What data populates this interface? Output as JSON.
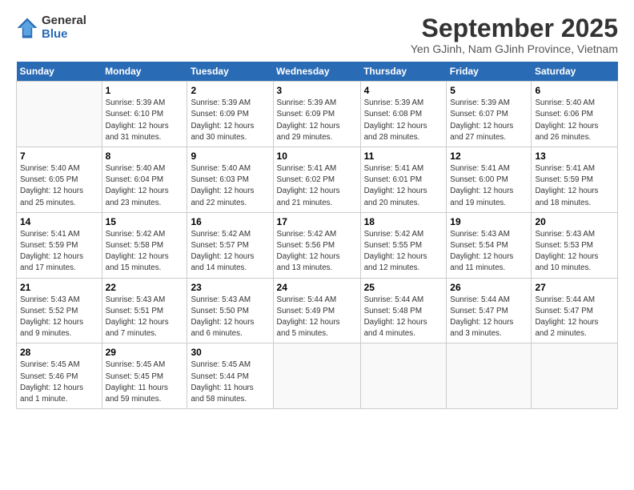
{
  "logo": {
    "general": "General",
    "blue": "Blue"
  },
  "title": "September 2025",
  "location": "Yen GJinh, Nam GJinh Province, Vietnam",
  "days_header": [
    "Sunday",
    "Monday",
    "Tuesday",
    "Wednesday",
    "Thursday",
    "Friday",
    "Saturday"
  ],
  "weeks": [
    [
      {
        "num": "",
        "info": ""
      },
      {
        "num": "1",
        "info": "Sunrise: 5:39 AM\nSunset: 6:10 PM\nDaylight: 12 hours\nand 31 minutes."
      },
      {
        "num": "2",
        "info": "Sunrise: 5:39 AM\nSunset: 6:09 PM\nDaylight: 12 hours\nand 30 minutes."
      },
      {
        "num": "3",
        "info": "Sunrise: 5:39 AM\nSunset: 6:09 PM\nDaylight: 12 hours\nand 29 minutes."
      },
      {
        "num": "4",
        "info": "Sunrise: 5:39 AM\nSunset: 6:08 PM\nDaylight: 12 hours\nand 28 minutes."
      },
      {
        "num": "5",
        "info": "Sunrise: 5:39 AM\nSunset: 6:07 PM\nDaylight: 12 hours\nand 27 minutes."
      },
      {
        "num": "6",
        "info": "Sunrise: 5:40 AM\nSunset: 6:06 PM\nDaylight: 12 hours\nand 26 minutes."
      }
    ],
    [
      {
        "num": "7",
        "info": "Sunrise: 5:40 AM\nSunset: 6:05 PM\nDaylight: 12 hours\nand 25 minutes."
      },
      {
        "num": "8",
        "info": "Sunrise: 5:40 AM\nSunset: 6:04 PM\nDaylight: 12 hours\nand 23 minutes."
      },
      {
        "num": "9",
        "info": "Sunrise: 5:40 AM\nSunset: 6:03 PM\nDaylight: 12 hours\nand 22 minutes."
      },
      {
        "num": "10",
        "info": "Sunrise: 5:41 AM\nSunset: 6:02 PM\nDaylight: 12 hours\nand 21 minutes."
      },
      {
        "num": "11",
        "info": "Sunrise: 5:41 AM\nSunset: 6:01 PM\nDaylight: 12 hours\nand 20 minutes."
      },
      {
        "num": "12",
        "info": "Sunrise: 5:41 AM\nSunset: 6:00 PM\nDaylight: 12 hours\nand 19 minutes."
      },
      {
        "num": "13",
        "info": "Sunrise: 5:41 AM\nSunset: 5:59 PM\nDaylight: 12 hours\nand 18 minutes."
      }
    ],
    [
      {
        "num": "14",
        "info": "Sunrise: 5:41 AM\nSunset: 5:59 PM\nDaylight: 12 hours\nand 17 minutes."
      },
      {
        "num": "15",
        "info": "Sunrise: 5:42 AM\nSunset: 5:58 PM\nDaylight: 12 hours\nand 15 minutes."
      },
      {
        "num": "16",
        "info": "Sunrise: 5:42 AM\nSunset: 5:57 PM\nDaylight: 12 hours\nand 14 minutes."
      },
      {
        "num": "17",
        "info": "Sunrise: 5:42 AM\nSunset: 5:56 PM\nDaylight: 12 hours\nand 13 minutes."
      },
      {
        "num": "18",
        "info": "Sunrise: 5:42 AM\nSunset: 5:55 PM\nDaylight: 12 hours\nand 12 minutes."
      },
      {
        "num": "19",
        "info": "Sunrise: 5:43 AM\nSunset: 5:54 PM\nDaylight: 12 hours\nand 11 minutes."
      },
      {
        "num": "20",
        "info": "Sunrise: 5:43 AM\nSunset: 5:53 PM\nDaylight: 12 hours\nand 10 minutes."
      }
    ],
    [
      {
        "num": "21",
        "info": "Sunrise: 5:43 AM\nSunset: 5:52 PM\nDaylight: 12 hours\nand 9 minutes."
      },
      {
        "num": "22",
        "info": "Sunrise: 5:43 AM\nSunset: 5:51 PM\nDaylight: 12 hours\nand 7 minutes."
      },
      {
        "num": "23",
        "info": "Sunrise: 5:43 AM\nSunset: 5:50 PM\nDaylight: 12 hours\nand 6 minutes."
      },
      {
        "num": "24",
        "info": "Sunrise: 5:44 AM\nSunset: 5:49 PM\nDaylight: 12 hours\nand 5 minutes."
      },
      {
        "num": "25",
        "info": "Sunrise: 5:44 AM\nSunset: 5:48 PM\nDaylight: 12 hours\nand 4 minutes."
      },
      {
        "num": "26",
        "info": "Sunrise: 5:44 AM\nSunset: 5:47 PM\nDaylight: 12 hours\nand 3 minutes."
      },
      {
        "num": "27",
        "info": "Sunrise: 5:44 AM\nSunset: 5:47 PM\nDaylight: 12 hours\nand 2 minutes."
      }
    ],
    [
      {
        "num": "28",
        "info": "Sunrise: 5:45 AM\nSunset: 5:46 PM\nDaylight: 12 hours\nand 1 minute."
      },
      {
        "num": "29",
        "info": "Sunrise: 5:45 AM\nSunset: 5:45 PM\nDaylight: 11 hours\nand 59 minutes."
      },
      {
        "num": "30",
        "info": "Sunrise: 5:45 AM\nSunset: 5:44 PM\nDaylight: 11 hours\nand 58 minutes."
      },
      {
        "num": "",
        "info": ""
      },
      {
        "num": "",
        "info": ""
      },
      {
        "num": "",
        "info": ""
      },
      {
        "num": "",
        "info": ""
      }
    ]
  ]
}
